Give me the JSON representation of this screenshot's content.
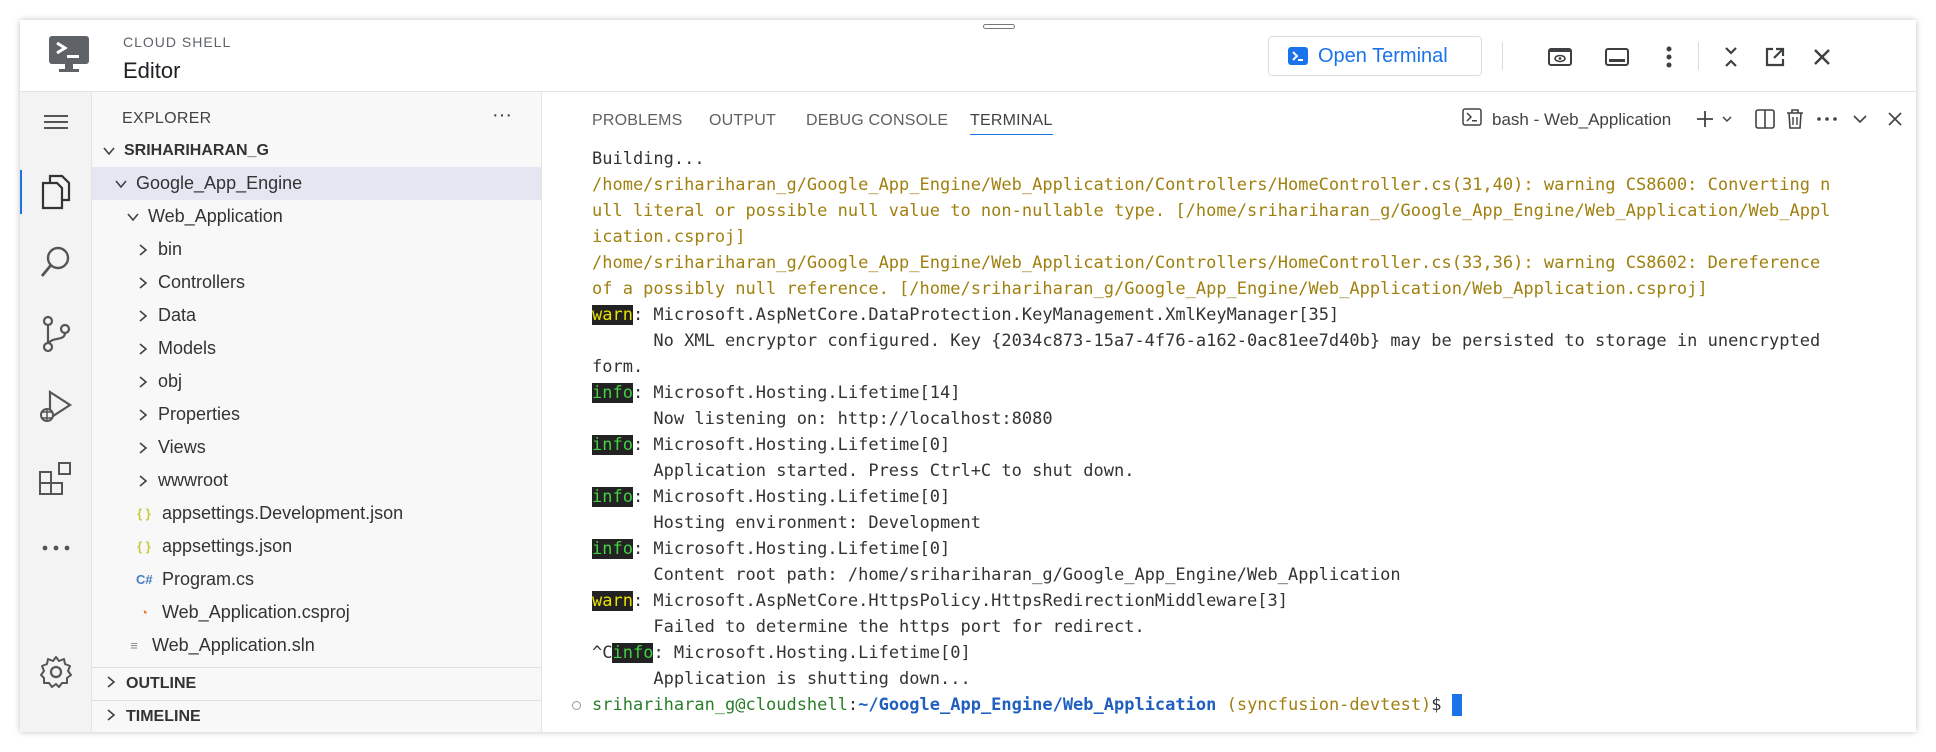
{
  "header": {
    "subtitle": "CLOUD SHELL",
    "title": "Editor",
    "open_terminal_label": "Open Terminal"
  },
  "explorer": {
    "title": "EXPLORER",
    "more": "···",
    "tree": [
      {
        "label": "SRIHARIHARAN_G",
        "kind": "root",
        "expanded": true
      },
      {
        "label": "Google_App_Engine",
        "kind": "folder",
        "expanded": true,
        "selected": true
      },
      {
        "label": "Web_Application",
        "kind": "folder",
        "expanded": true
      },
      {
        "label": "bin",
        "kind": "folder",
        "expanded": false
      },
      {
        "label": "Controllers",
        "kind": "folder",
        "expanded": false
      },
      {
        "label": "Data",
        "kind": "folder",
        "expanded": false
      },
      {
        "label": "Models",
        "kind": "folder",
        "expanded": false
      },
      {
        "label": "obj",
        "kind": "folder",
        "expanded": false
      },
      {
        "label": "Properties",
        "kind": "folder",
        "expanded": false
      },
      {
        "label": "Views",
        "kind": "folder",
        "expanded": false
      },
      {
        "label": "wwwroot",
        "kind": "folder",
        "expanded": false
      },
      {
        "label": "appsettings.Development.json",
        "kind": "json"
      },
      {
        "label": "appsettings.json",
        "kind": "json"
      },
      {
        "label": "Program.cs",
        "kind": "cs"
      },
      {
        "label": "Web_Application.csproj",
        "kind": "rss"
      },
      {
        "label": "Web_Application.sln",
        "kind": "sln"
      }
    ],
    "outline": "OUTLINE",
    "timeline": "TIMELINE"
  },
  "panel": {
    "tabs": [
      "PROBLEMS",
      "OUTPUT",
      "DEBUG CONSOLE",
      "TERMINAL"
    ],
    "terminal_name": "bash - Web_Application"
  },
  "terminal": {
    "lines": [
      {
        "type": "plain",
        "text": "Building..."
      },
      {
        "type": "warn",
        "text": "/home/srihariharan_g/Google_App_Engine/Web_Application/Controllers/HomeController.cs(31,40): warning CS8600: Converting n"
      },
      {
        "type": "warn",
        "text": "ull literal or possible null value to non-nullable type. [/home/srihariharan_g/Google_App_Engine/Web_Application/Web_Appl"
      },
      {
        "type": "warn",
        "text": "ication.csproj]"
      },
      {
        "type": "warn",
        "text": "/home/srihariharan_g/Google_App_Engine/Web_Application/Controllers/HomeController.cs(33,36): warning CS8602: Dereference"
      },
      {
        "type": "warn",
        "text": "of a possibly null reference. [/home/srihariharan_g/Google_App_Engine/Web_Application/Web_Application.csproj]"
      },
      {
        "type": "log",
        "badge": "warn",
        "text": ": Microsoft.AspNetCore.DataProtection.KeyManagement.XmlKeyManager[35]"
      },
      {
        "type": "plain",
        "text": "      No XML encryptor configured. Key {2034c873-15a7-4f76-a162-0ac81ee7d40b} may be persisted to storage in unencrypted"
      },
      {
        "type": "plain",
        "text": "form."
      },
      {
        "type": "log",
        "badge": "info",
        "text": ": Microsoft.Hosting.Lifetime[14]"
      },
      {
        "type": "plain",
        "text": "      Now listening on: http://localhost:8080"
      },
      {
        "type": "log",
        "badge": "info",
        "text": ": Microsoft.Hosting.Lifetime[0]"
      },
      {
        "type": "plain",
        "text": "      Application started. Press Ctrl+C to shut down."
      },
      {
        "type": "log",
        "badge": "info",
        "text": ": Microsoft.Hosting.Lifetime[0]"
      },
      {
        "type": "plain",
        "text": "      Hosting environment: Development"
      },
      {
        "type": "log",
        "badge": "info",
        "text": ": Microsoft.Hosting.Lifetime[0]"
      },
      {
        "type": "plain",
        "text": "      Content root path: /home/srihariharan_g/Google_App_Engine/Web_Application"
      },
      {
        "type": "log",
        "badge": "warn",
        "text": ": Microsoft.AspNetCore.HttpsPolicy.HttpsRedirectionMiddleware[3]"
      },
      {
        "type": "plain",
        "text": "      Failed to determine the https port for redirect."
      },
      {
        "type": "log",
        "badge": "info",
        "prefix": "^C",
        "text": ": Microsoft.Hosting.Lifetime[0]"
      },
      {
        "type": "plain",
        "text": "      Application is shutting down..."
      }
    ],
    "prompt": {
      "user": "srihariharan_g@cloudshell",
      "sep": ":",
      "path": "~/Google_App_Engine/Web_Application",
      "branch": " (syncfusion-devtest)",
      "symbol": "$ "
    }
  },
  "colors": {
    "accent": "#1a73e8",
    "warn_text": "#a08010",
    "info_badge": "#43d043",
    "warn_badge": "#e8e000"
  }
}
